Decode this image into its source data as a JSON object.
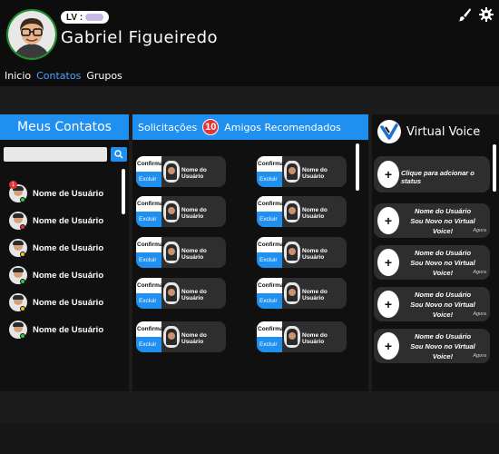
{
  "header": {
    "level_label": "LV :",
    "username": "Gabriel Figueiredo",
    "brush_icon": "brush-icon",
    "settings_icon": "gear-icon"
  },
  "nav": {
    "items": [
      "Inicio",
      "Contatos",
      "Grupos"
    ],
    "active": "Contatos"
  },
  "contacts_panel": {
    "title": "Meus Contatos",
    "search_placeholder": "",
    "notification_count": "1",
    "contacts": [
      {
        "name": "Nome de Usuário",
        "status": "#2ecc40"
      },
      {
        "name": "Nome de Usuário",
        "status": "#e53434"
      },
      {
        "name": "Nome de Usuário",
        "status": "#f0c419"
      },
      {
        "name": "Nome de Usuário",
        "status": "#2ecc40"
      },
      {
        "name": "Nome de Usuário",
        "status": "#f0c419"
      },
      {
        "name": "Nome de Usuário",
        "status": "#2ecc40"
      }
    ]
  },
  "requests_panel": {
    "tab_requests": "Solicitações",
    "request_count": "10",
    "tab_recommended": "Amigos Recomendados",
    "confirm_label": "Confirmar",
    "delete_label": "Excluir",
    "user_label": "Nome do Usuário",
    "count": 10
  },
  "voice_panel": {
    "title": "Virtual Voice",
    "add_status": "Clique para adcionar o status",
    "plus": "+",
    "posts": [
      {
        "user": "Nome do Usuário",
        "text": "Sou Novo no Virtual Voice!",
        "time": "Agora"
      },
      {
        "user": "Nome do Usuário",
        "text": "Sou Novo no Virtual Voice!",
        "time": "Agora"
      },
      {
        "user": "Nome do Usuário",
        "text": "Sou Novo no Virtual Voice!",
        "time": "Agora"
      },
      {
        "user": "Nome do Usuário",
        "text": "Sou Novo no Virtual Voice!",
        "time": "Agora"
      }
    ]
  },
  "colors": {
    "accent": "#1f8ff0",
    "background": "#1c1c1c",
    "panel": "#101010",
    "card": "#2e2e2e",
    "avatar_ring": "#1f8f2e"
  }
}
